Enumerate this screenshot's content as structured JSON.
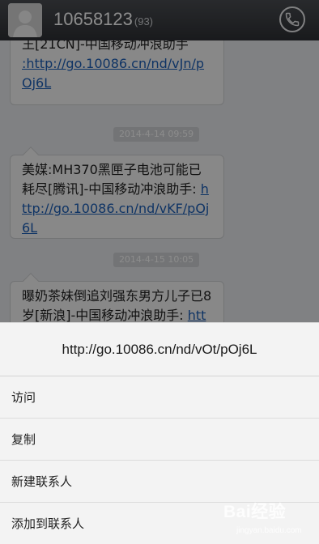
{
  "header": {
    "title": "10658123",
    "count": "(93)",
    "avatar_icon": "default-avatar-icon",
    "call_icon": "phone-icon"
  },
  "messages": [
    {
      "text": "王[21CN]-中国移动冲浪助手",
      "link": ":http://go.10086.cn/nd/vJn/pOj6L"
    },
    {
      "timestamp": "2014-4-14 09:59",
      "text": "美媒:MH370黑匣子电池可能已耗尽[腾讯]-中国移动冲浪助手:",
      "link": "http://go.10086.cn/nd/vKF/pOj6L"
    },
    {
      "timestamp": "2014-4-15 10:05",
      "text": "曝奶茶妹倒追刘强东男方儿子已8岁[新浪]-中国移动冲浪助手:",
      "link": "http://"
    }
  ],
  "context_menu": {
    "url": "http://go.10086.cn/nd/vOt/pOj6L",
    "items": [
      "访问",
      "复制",
      "新建联系人",
      "添加到联系人"
    ]
  },
  "watermark": {
    "main": "Bai经验",
    "sub": "jingyan.baidu.com"
  }
}
